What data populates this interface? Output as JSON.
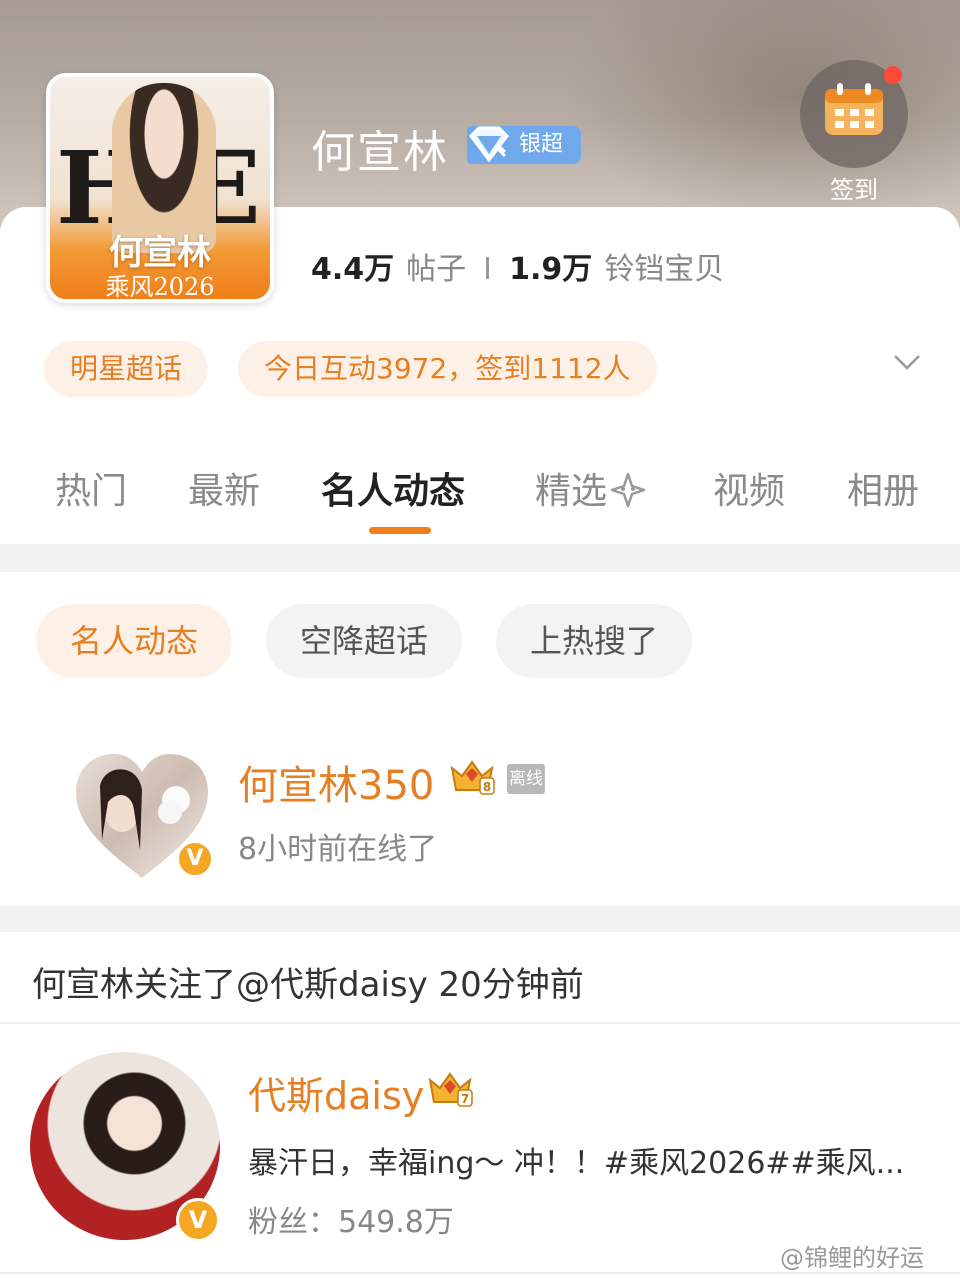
{
  "header": {
    "title": "何宣林",
    "badge_label": "银超",
    "checkin_label": "签到",
    "cover": {
      "letters": "HE",
      "name": "何宣林",
      "subtitle": "乘风2026"
    }
  },
  "stats": {
    "posts_value": "4.4万",
    "posts_label": "帖子",
    "fans_value": "1.9万",
    "fans_label": "铃铛宝贝"
  },
  "chips": {
    "category": "明星超话",
    "activity": "今日互动3972，签到1112人"
  },
  "tabs": [
    {
      "label": "热门"
    },
    {
      "label": "最新"
    },
    {
      "label": "名人动态"
    },
    {
      "label": "精选"
    },
    {
      "label": "视频"
    },
    {
      "label": "相册"
    }
  ],
  "active_tab": "名人动态",
  "subtabs": [
    {
      "label": "名人动态"
    },
    {
      "label": "空降超话"
    },
    {
      "label": "上热搜了"
    }
  ],
  "celebrity": {
    "name": "何宣林350",
    "level": "8",
    "status": "离线",
    "online_time": "8小时前在线了",
    "verified": "V"
  },
  "feed": {
    "activity_text": "何宣林关注了@代斯daisy 20分钟前"
  },
  "followed_user": {
    "name": "代斯daisy",
    "level": "7",
    "description": "暴汗日，幸福ing～ 冲！！#乘风2026##乘风...",
    "fans": "粉丝：549.8万",
    "verified": "V"
  },
  "watermark": "@锦鲤的好运",
  "colors": {
    "accent": "#e67e22",
    "accent_bg": "#fdf1e7",
    "badge_blue": "#6fa9ec",
    "verified_gold": "#f5a623",
    "notification_red": "#ff4a3a"
  }
}
